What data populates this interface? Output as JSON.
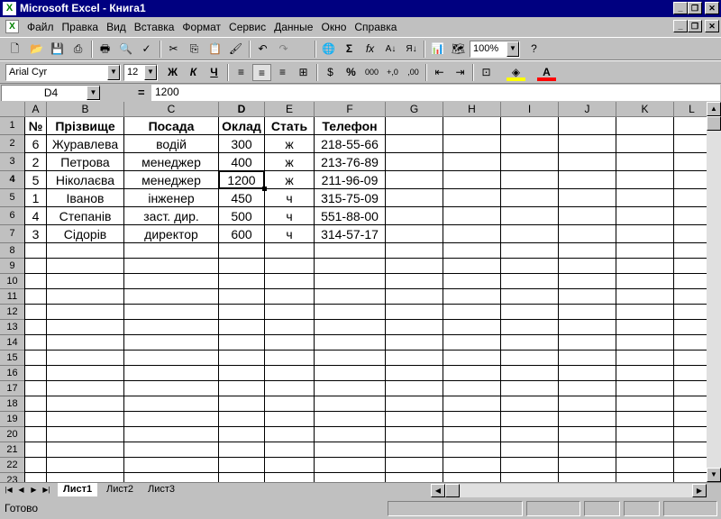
{
  "window": {
    "title": "Microsoft Excel - Книга1",
    "app_icon": "excel-icon",
    "controls": [
      "_",
      "❐",
      "✕"
    ]
  },
  "menu": {
    "items": [
      "Файл",
      "Правка",
      "Вид",
      "Вставка",
      "Формат",
      "Сервис",
      "Данные",
      "Окно",
      "Справка"
    ]
  },
  "toolbar_standard": {
    "zoom": "100%",
    "icons": [
      "new-icon",
      "open-icon",
      "save-icon",
      "print-icon",
      "print-preview-icon",
      "spelling-icon",
      "cut-icon",
      "copy-icon",
      "paste-icon",
      "format-painter-icon",
      "undo-icon",
      "redo-icon",
      "hyperlink-icon",
      "autosum-icon",
      "function-icon",
      "sort-asc-icon",
      "sort-desc-icon",
      "chart-wizard-icon",
      "map-icon",
      "help-icon"
    ]
  },
  "toolbar_formatting": {
    "font_name": "Arial Cyr",
    "font_size": "12",
    "bold": "Ж",
    "italic": "К",
    "underline": "Ч",
    "percent": "%",
    "thousands": "000",
    "currency": "$",
    "increase_decimal": "+,0",
    "decrease_decimal": ",00"
  },
  "formula_bar": {
    "name_box": "D4",
    "equals": "=",
    "formula": "1200"
  },
  "grid": {
    "columns": [
      "A",
      "B",
      "C",
      "D",
      "E",
      "F",
      "G",
      "H",
      "I",
      "J",
      "K",
      "L"
    ],
    "active_column": "D",
    "active_row": "4",
    "rows": [
      "1",
      "2",
      "3",
      "4",
      "5",
      "6",
      "7",
      "8",
      "9",
      "10",
      "11",
      "12",
      "13",
      "14",
      "15",
      "16",
      "17",
      "18",
      "19",
      "20",
      "21",
      "22",
      "23"
    ],
    "headers": [
      "№",
      "Прізвище",
      "Посада",
      "Оклад",
      "Стать",
      "Телефон"
    ],
    "data": [
      [
        "6",
        "Журавлева",
        "водій",
        "300",
        "ж",
        "218-55-66"
      ],
      [
        "2",
        "Петрова",
        "менеджер",
        "400",
        "ж",
        "213-76-89"
      ],
      [
        "5",
        "Ніколаєва",
        "менеджер",
        "1200",
        "ж",
        "211-96-09"
      ],
      [
        "1",
        "Іванов",
        "інженер",
        "450",
        "ч",
        "315-75-09"
      ],
      [
        "4",
        "Степанів",
        "заст. дир.",
        "500",
        "ч",
        "551-88-00"
      ],
      [
        "3",
        "Сідорів",
        "директор",
        "600",
        "ч",
        "314-57-17"
      ]
    ]
  },
  "sheets": {
    "tabs": [
      "Лист1",
      "Лист2",
      "Лист3"
    ],
    "active": "Лист1"
  },
  "status": {
    "text": "Готово"
  }
}
